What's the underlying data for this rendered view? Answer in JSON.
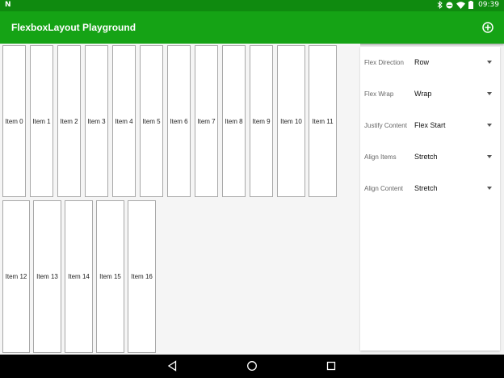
{
  "status_bar": {
    "notification_icon": "N",
    "time": "09:39",
    "icons": [
      "bluetooth-icon",
      "do-not-disturb-icon",
      "wifi-icon",
      "battery-icon"
    ]
  },
  "app_bar": {
    "title": "FlexboxLayout Playground",
    "add_icon": "add-circle-icon"
  },
  "flex_items": [
    {
      "label": "Item 0"
    },
    {
      "label": "Item 1"
    },
    {
      "label": "Item 2"
    },
    {
      "label": "Item 3"
    },
    {
      "label": "Item 4"
    },
    {
      "label": "Item 5"
    },
    {
      "label": "Item 6"
    },
    {
      "label": "Item 7"
    },
    {
      "label": "Item 8"
    },
    {
      "label": "Item 9"
    },
    {
      "label": "Item 10"
    },
    {
      "label": "Item 11"
    },
    {
      "label": "Item 12"
    },
    {
      "label": "Item 13"
    },
    {
      "label": "Item 14"
    },
    {
      "label": "Item 15"
    },
    {
      "label": "Item 16"
    }
  ],
  "settings": {
    "flex_direction": {
      "label": "Flex Direction",
      "value": "Row"
    },
    "flex_wrap": {
      "label": "Flex Wrap",
      "value": "Wrap"
    },
    "justify_content": {
      "label": "Justify Content",
      "value": "Flex Start"
    },
    "align_items": {
      "label": "Align Items",
      "value": "Stretch"
    },
    "align_content": {
      "label": "Align Content",
      "value": "Stretch"
    }
  },
  "nav_bar": {
    "icons": [
      "back-icon",
      "home-icon",
      "recents-icon"
    ]
  },
  "colors": {
    "status_bar": "#0f8a0f",
    "app_bar": "#15a315",
    "background": "#f5f5f5"
  }
}
